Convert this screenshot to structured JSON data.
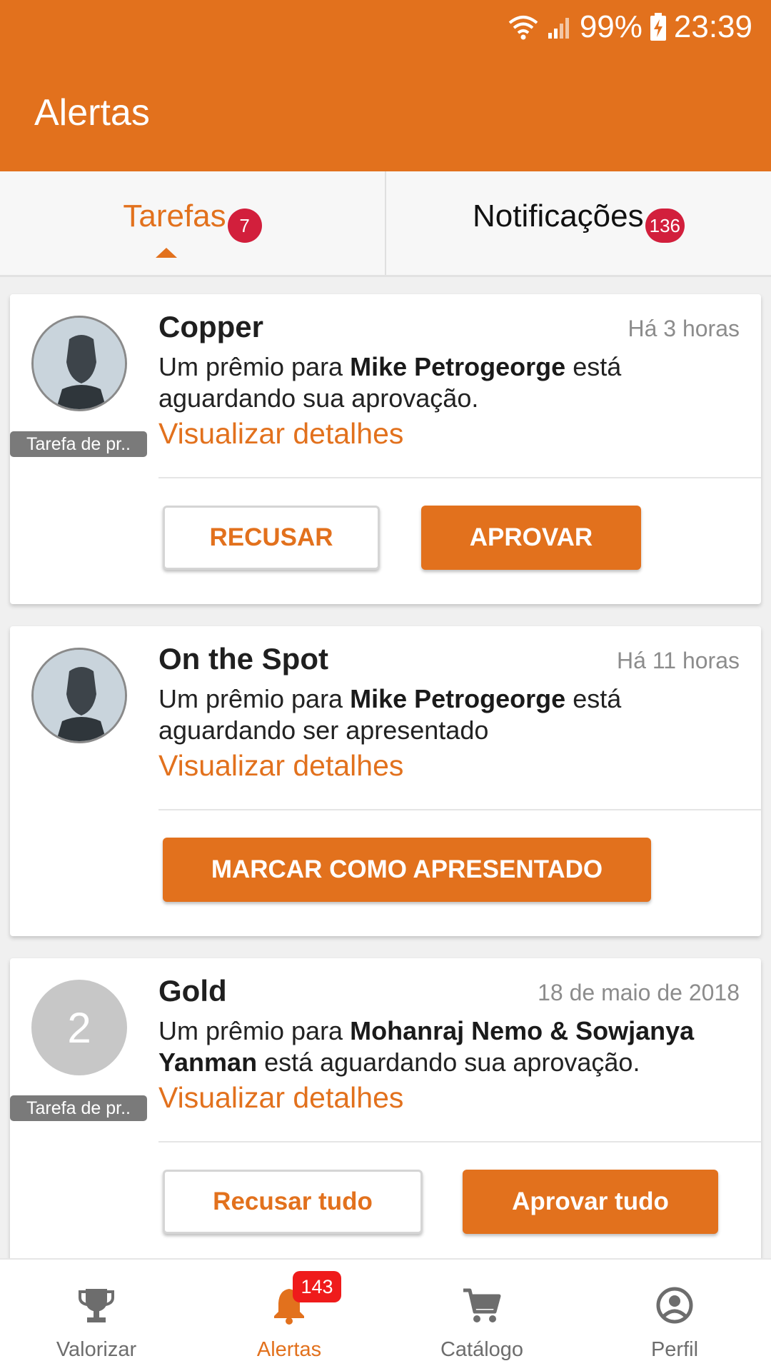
{
  "status_bar": {
    "battery": "99%",
    "time": "23:39"
  },
  "app_bar": {
    "title": "Alertas"
  },
  "tabs": [
    {
      "label": "Tarefas",
      "badge": "7",
      "active": true
    },
    {
      "label": "Notificações",
      "badge": "136",
      "active": false
    }
  ],
  "cards": [
    {
      "title": "Copper",
      "time": "Há 3 horas",
      "tag": "Tarefa de pr..",
      "message_prefix": "Um prêmio para ",
      "message_name": "Mike Petrogeorge",
      "message_suffix": " está aguardando sua aprovação.",
      "link": "Visualizar detalhes",
      "buttons": {
        "decline": "RECUSAR",
        "approve": "APROVAR"
      }
    },
    {
      "title": "On the Spot",
      "time": "Há 11 horas",
      "message_prefix": "Um prêmio para ",
      "message_name": "Mike Petrogeorge",
      "message_suffix": " está aguardando ser apresentado",
      "link": "Visualizar detalhes",
      "buttons": {
        "present": "MARCAR COMO APRESENTADO"
      }
    },
    {
      "title": "Gold",
      "time": "18 de maio de 2018",
      "tag": "Tarefa de pr..",
      "avatar_number": "2",
      "message_prefix": "Um prêmio para ",
      "message_name": "Mohanraj Nemo & Sowjanya Yanman",
      "message_suffix": " está aguardando sua aprovação.",
      "link": "Visualizar detalhes",
      "buttons": {
        "decline_all": "Recusar tudo",
        "approve_all": "Aprovar tudo"
      }
    }
  ],
  "bottom_nav": [
    {
      "label": "Valorizar",
      "icon": "trophy-icon"
    },
    {
      "label": "Alertas",
      "icon": "bell-icon",
      "badge": "143",
      "active": true
    },
    {
      "label": "Catálogo",
      "icon": "cart-icon"
    },
    {
      "label": "Perfil",
      "icon": "profile-icon"
    }
  ],
  "colors": {
    "accent": "#e2711d",
    "badge_red": "#d21f3c",
    "nav_badge_red": "#ef1b1b"
  }
}
